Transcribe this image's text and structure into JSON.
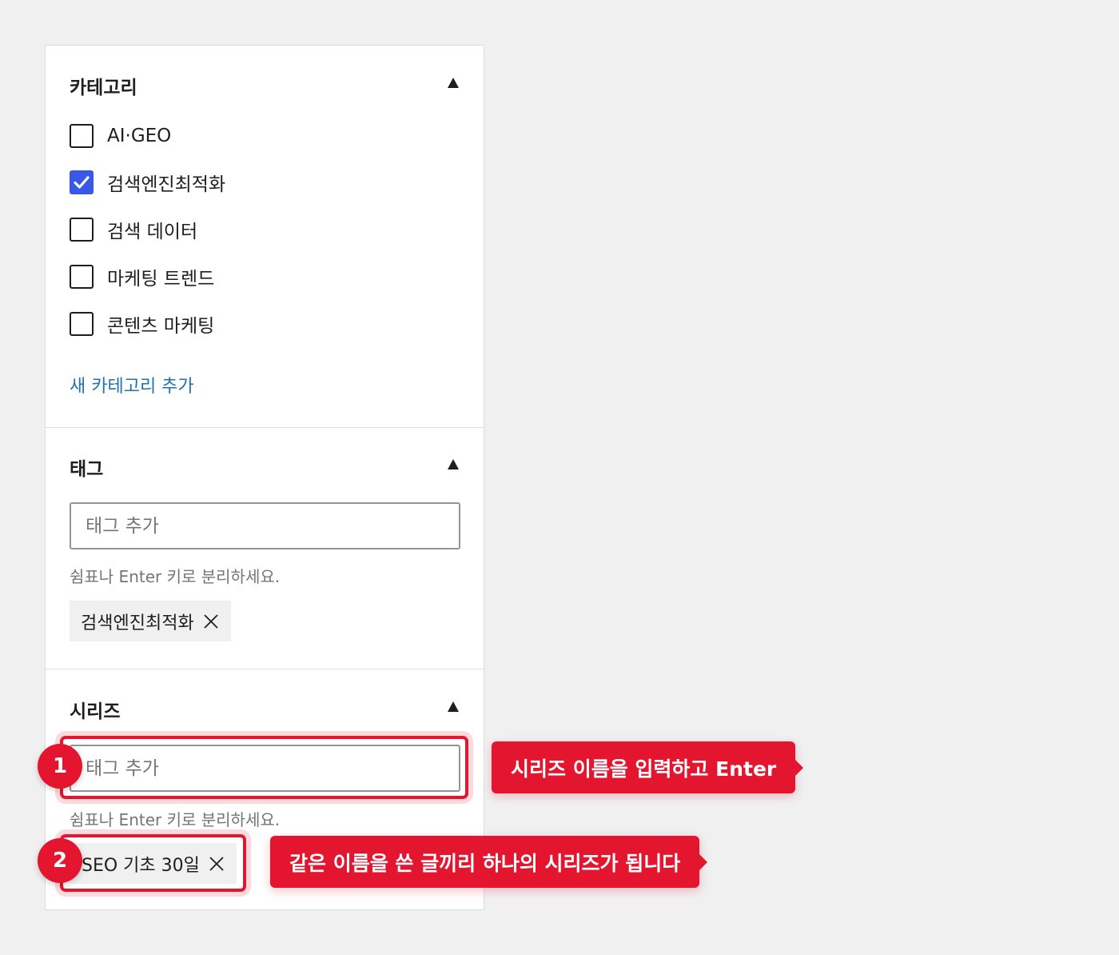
{
  "categories": {
    "title": "카테고리",
    "items": [
      {
        "label": "AI·GEO",
        "checked": false
      },
      {
        "label": "검색엔진최적화",
        "checked": true
      },
      {
        "label": "검색 데이터",
        "checked": false
      },
      {
        "label": "마케팅 트렌드",
        "checked": false
      },
      {
        "label": "콘텐츠 마케팅",
        "checked": false
      }
    ],
    "add_link": "새 카테고리 추가"
  },
  "tags": {
    "title": "태그",
    "placeholder": "태그 추가",
    "help": "쉼표나 Enter 키로 분리하세요.",
    "chip": "검색엔진최적화"
  },
  "series": {
    "title": "시리즈",
    "placeholder": "태그 추가",
    "help": "쉼표나 Enter 키로 분리하세요.",
    "chip": "SEO 기초 30일"
  },
  "annotations": [
    {
      "number": "1",
      "text": "시리즈 이름을 입력하고 Enter"
    },
    {
      "number": "2",
      "text": "같은 이름을 쓴 글끼리 하나의 시리즈가 됩니다"
    }
  ],
  "colors": {
    "accent_red": "#e4162f",
    "checkbox_blue": "#3858e9",
    "link_blue": "#2271b1",
    "background": "#f0f0f1"
  },
  "icons": {
    "collapse": "caret-up-icon",
    "remove": "close-icon",
    "check": "checkmark-icon"
  }
}
